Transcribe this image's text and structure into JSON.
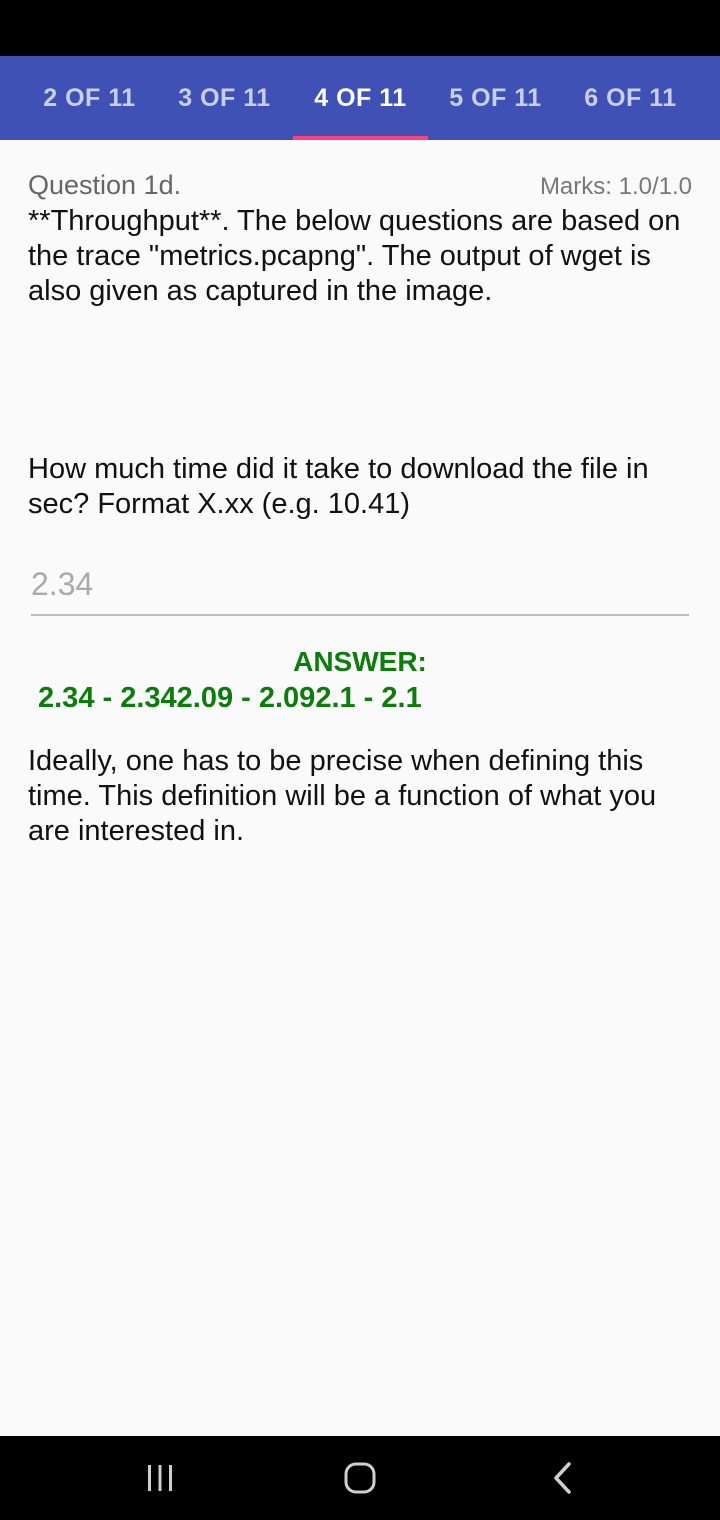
{
  "tabs": [
    {
      "label": "2 OF 11",
      "active": false
    },
    {
      "label": "3 OF 11",
      "active": false
    },
    {
      "label": "4 OF 11",
      "active": true
    },
    {
      "label": "5 OF 11",
      "active": false
    },
    {
      "label": "6 OF 11",
      "active": false
    }
  ],
  "question": {
    "title": "Question 1d.",
    "marks": "Marks: 1.0/1.0",
    "text": "**Throughput**. The below questions are based on the trace \"metrics.pcapng\". The output of wget is also given as captured in the image.",
    "prompt": "How much time did it take to download the file in sec? Format X.xx (e.g. 10.41)"
  },
  "input": {
    "value": "2.34"
  },
  "answer": {
    "label": "ANSWER:",
    "values": "2.34 - 2.342.09 - 2.092.1 - 2.1"
  },
  "feedback": "Ideally, one has to be precise when defining this time. This definition will be a function of what you are interested in.",
  "colors": {
    "tab_bar": "#3f51b5",
    "tab_indicator": "#ff4081",
    "answer": "#0a7d0a"
  },
  "nav": {
    "icons": [
      "recent-apps-icon",
      "home-icon",
      "back-icon"
    ]
  }
}
